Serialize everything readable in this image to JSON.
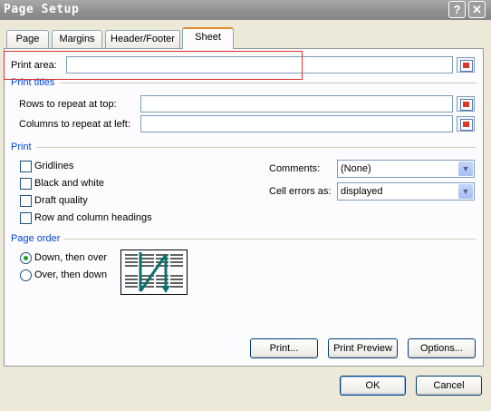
{
  "window": {
    "title": "Page Setup"
  },
  "tabs": [
    {
      "label": "Page",
      "active": false
    },
    {
      "label": "Margins",
      "active": false
    },
    {
      "label": "Header/Footer",
      "active": false
    },
    {
      "label": "Sheet",
      "active": true
    }
  ],
  "print_area": {
    "label": "Print area:",
    "value": ""
  },
  "print_titles": {
    "heading": "Print titles",
    "rows_label": "Rows to repeat at top:",
    "rows_value": "",
    "columns_label": "Columns to repeat at left:",
    "columns_value": ""
  },
  "print": {
    "heading": "Print",
    "options": [
      {
        "label": "Gridlines",
        "checked": false
      },
      {
        "label": "Black and white",
        "checked": false
      },
      {
        "label": "Draft quality",
        "checked": false
      },
      {
        "label": "Row and column headings",
        "checked": false
      }
    ],
    "comments": {
      "label": "Comments:",
      "value": "(None)"
    },
    "cell_errors": {
      "label": "Cell errors as:",
      "value": "displayed"
    }
  },
  "page_order": {
    "heading": "Page order",
    "options": [
      {
        "label": "Down, then over",
        "selected": true
      },
      {
        "label": "Over, then down",
        "selected": false
      }
    ]
  },
  "panel_buttons": {
    "print": "Print...",
    "print_preview": "Print Preview",
    "options": "Options..."
  },
  "dialog_buttons": {
    "ok": "OK",
    "cancel": "Cancel"
  },
  "colors": {
    "group_heading": "#0046d5",
    "active_tab_accent": "#e68b2c",
    "highlight": "#e0302c",
    "radio_selected": "#21a121"
  }
}
